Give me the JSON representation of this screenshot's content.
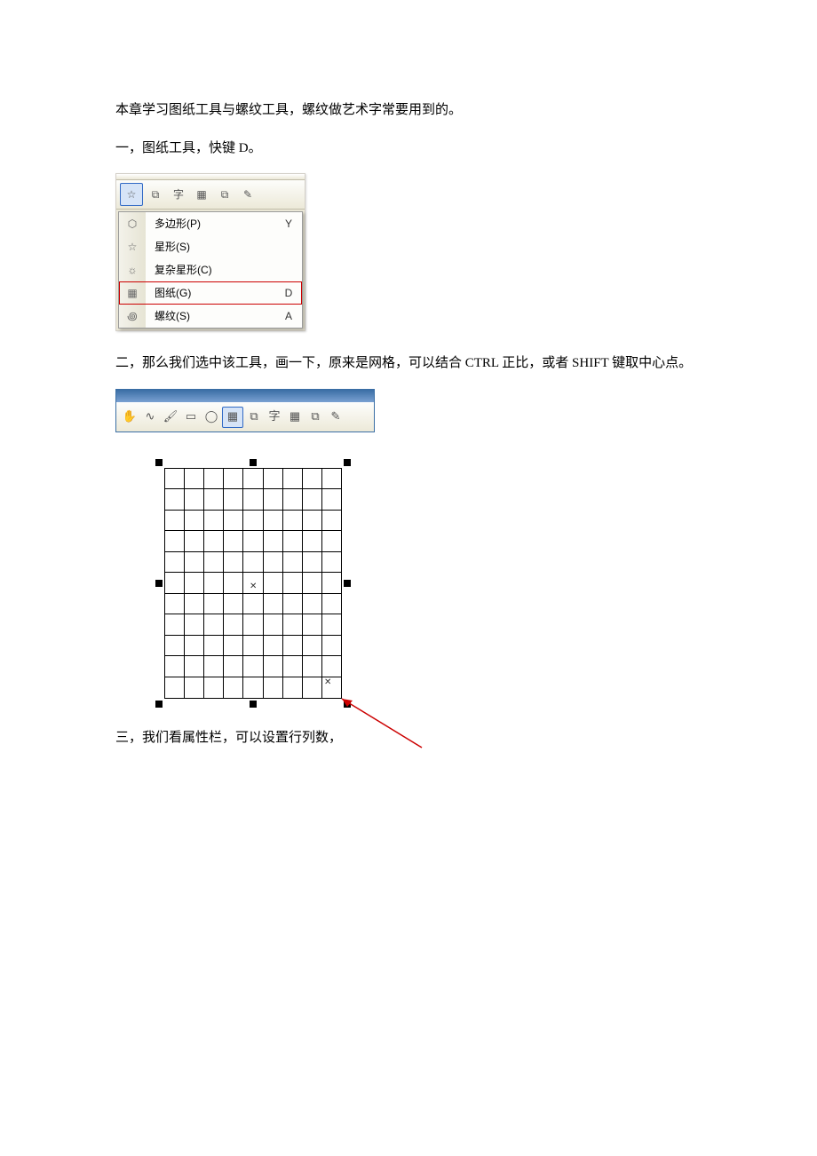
{
  "intro": "本章学习图纸工具与螺纹工具，螺纹做艺术字常要用到的。",
  "section1": "一，图纸工具，快键 D。",
  "menu": {
    "items": [
      {
        "label": "多边形(P)",
        "key": "Y",
        "icon": "hexagon-icon"
      },
      {
        "label": "星形(S)",
        "key": "",
        "icon": "star-icon"
      },
      {
        "label": "复杂星形(C)",
        "key": "",
        "icon": "sun-icon"
      },
      {
        "label": "图纸(G)",
        "key": "D",
        "icon": "graph-paper-icon",
        "highlight": true
      },
      {
        "label": "螺纹(S)",
        "key": "A",
        "icon": "spiral-icon"
      }
    ]
  },
  "section2": "二，那么我们选中该工具，画一下，原来是网格，可以结合 CTRL 正比，或者 SHIFT 键取中心点。",
  "section3": "三，我们看属性栏，可以设置行列数，",
  "glyphs": {
    "star": "☆",
    "hexagon": "⬡",
    "sun": "☼",
    "spiral": "꩜",
    "graphpaper": "▦",
    "hand": "✋",
    "zigzag": "∿",
    "paint": "🖌",
    "square": "▭",
    "circle": "◯",
    "char": "字",
    "table": "▦",
    "group": "⧉",
    "eyedrop": "✎"
  },
  "grid": {
    "rows": 11,
    "cols": 9
  }
}
